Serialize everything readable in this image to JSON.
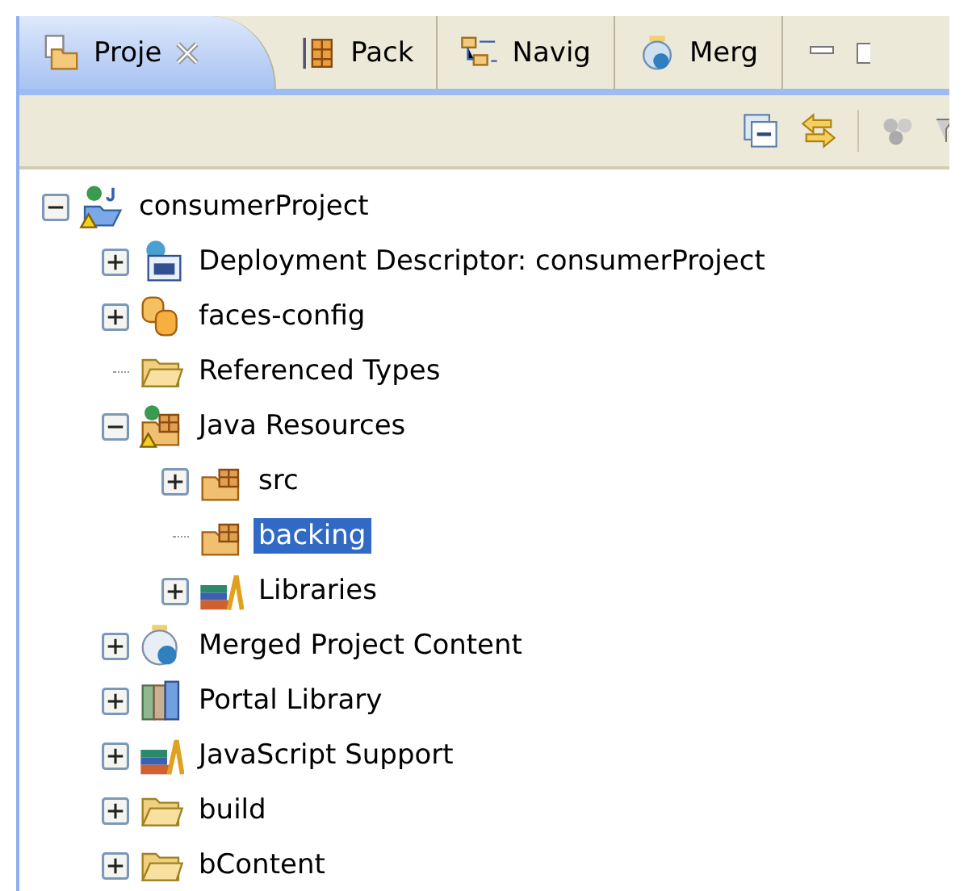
{
  "tabs": [
    {
      "label": "Proje",
      "kind": "project",
      "selected": true,
      "closable": true
    },
    {
      "label": "Pack",
      "kind": "package",
      "selected": false
    },
    {
      "label": "Navig",
      "kind": "navigator",
      "selected": false
    },
    {
      "label": "Merg",
      "kind": "merged",
      "selected": false
    }
  ],
  "tree": [
    {
      "label": "consumerProject",
      "kind": "project",
      "expanded": true,
      "selected": false,
      "children": [
        {
          "label": "Deployment Descriptor: consumerProject",
          "kind": "descriptor",
          "expanded": false,
          "selected": false
        },
        {
          "label": "faces-config",
          "kind": "faces",
          "expanded": false,
          "selected": false
        },
        {
          "label": "Referenced Types",
          "kind": "folder",
          "selected": false
        },
        {
          "label": "Java Resources",
          "kind": "java",
          "expanded": true,
          "selected": false,
          "children": [
            {
              "label": "src",
              "kind": "package-folder",
              "expanded": false,
              "selected": false
            },
            {
              "label": "backing",
              "kind": "package-folder",
              "selected": true
            },
            {
              "label": "Libraries",
              "kind": "libraries",
              "expanded": false,
              "selected": false
            }
          ]
        },
        {
          "label": "Merged Project Content",
          "kind": "merged",
          "expanded": false,
          "selected": false
        },
        {
          "label": "Portal Library",
          "kind": "portal",
          "expanded": false,
          "selected": false
        },
        {
          "label": "JavaScript Support",
          "kind": "libraries",
          "expanded": false,
          "selected": false
        },
        {
          "label": "build",
          "kind": "folder",
          "expanded": false,
          "selected": false
        },
        {
          "label": "bContent",
          "kind": "folder",
          "expanded": false,
          "selected": false
        }
      ]
    }
  ]
}
